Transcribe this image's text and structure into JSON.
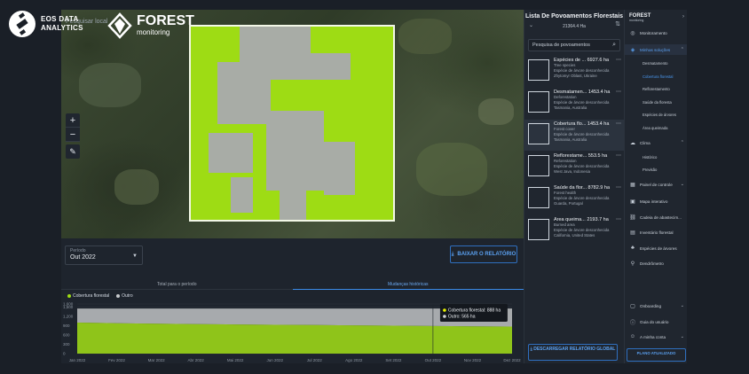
{
  "brand": {
    "eos_line1": "EOS DATA",
    "eos_line2": "ANALYTICS",
    "forest_title": "FOREST",
    "forest_sub": "monitoring"
  },
  "map": {
    "search_ghost": "Pesquisar local",
    "zoom_in": "+",
    "zoom_out": "−",
    "ruler_icon": "ruler-icon"
  },
  "bottom": {
    "period_label": "Período",
    "period_value": "Out 2022",
    "report_button": "BAIXAR O RELATÓRIO",
    "tabs": [
      "Total para o período",
      "Mudanças históricas"
    ],
    "legend": [
      {
        "label": "Cobertura florestal",
        "color": "#9edc14"
      },
      {
        "label": "Outro",
        "color": "#b9bcbf"
      }
    ]
  },
  "chart_data": {
    "type": "area",
    "x": [
      "Jan 2022",
      "Fev 2022",
      "Mar 2022",
      "Abr 2022",
      "Mai 2022",
      "Jun 2022",
      "Jul 2022",
      "Ago 2022",
      "Set 2022",
      "Out 2022",
      "Nov 2022",
      "Dez 2022"
    ],
    "series": [
      {
        "name": "Cobertura florestal",
        "color": "#8fc41a",
        "values": [
          1000,
          980,
          965,
          950,
          940,
          930,
          920,
          910,
          900,
          888,
          880,
          870
        ]
      },
      {
        "name": "Outro",
        "color": "#a7aaad",
        "values": [
          453,
          473,
          488,
          503,
          513,
          523,
          533,
          543,
          553,
          565,
          573,
          583
        ]
      }
    ],
    "yticks": [
      "1,600",
      "1,500",
      "1,200",
      "900",
      "600",
      "300",
      "0"
    ],
    "ylim": [
      0,
      1600
    ],
    "tooltip": {
      "row1": "Cobertura florestal: 888 ha",
      "row2": "Outro: 565 ha"
    }
  },
  "list": {
    "title": "Lista De Povoamentos Florestais",
    "area": "21364.4 Ha",
    "search_placeholder": "Pesquisa de povoamentos",
    "items": [
      {
        "name": "Espécies de ...",
        "area": "6927.6 ha",
        "l1": "Tree species",
        "l2": "Espécie de árvore desconhecida",
        "l3": "Zhytomyr Oblast, Ukraine"
      },
      {
        "name": "Desmatamen...",
        "area": "1453.4 ha",
        "l1": "Deforestation",
        "l2": "Espécie de árvore desconhecida",
        "l3": "Tasmania, Australia"
      },
      {
        "name": "Cobertura flo...",
        "area": "1453.4 ha",
        "l1": "Forest cover",
        "l2": "Espécie de árvore desconhecida",
        "l3": "Tasmania, Australia"
      },
      {
        "name": "Reflorestame...",
        "area": "553.5 ha",
        "l1": "Reforestation",
        "l2": "Espécie de árvore desconhecida",
        "l3": "West Java, Indonesia"
      },
      {
        "name": "Saúde da flor...",
        "area": "8782.9 ha",
        "l1": "Forest health",
        "l2": "Espécie de árvore desconhecida",
        "l3": "Guarda, Portugal"
      },
      {
        "name": "Área queima...",
        "area": "2193.7 ha",
        "l1": "Burned area",
        "l2": "Espécie de árvore desconhecida",
        "l3": "California, United States"
      }
    ],
    "download_button": "DESCARREGAR RELATÓRIO GLOBAL"
  },
  "sidebar": {
    "logo": "FOREST",
    "logo_sub": "monitoring",
    "items": [
      {
        "label": "Monitoramento",
        "icon": "globe-icon"
      },
      {
        "label": "Minhas soluções",
        "icon": "layers-icon"
      },
      {
        "label": "Clima",
        "icon": "cloud-icon"
      },
      {
        "label": "Painel de controle",
        "icon": "dashboard-icon"
      },
      {
        "label": "Mapa interativo",
        "icon": "map-icon"
      },
      {
        "label": "Cadeia de abastecim...",
        "icon": "chain-icon"
      },
      {
        "label": "Inventário florestal",
        "icon": "inventory-icon"
      },
      {
        "label": "Espécies de árvores",
        "icon": "tree-icon"
      },
      {
        "label": "Dendrômetro",
        "icon": "dendrometer-icon"
      },
      {
        "label": "Onboarding",
        "icon": "onboarding-icon"
      },
      {
        "label": "Guia do usuário",
        "icon": "info-icon"
      },
      {
        "label": "A minha conta",
        "icon": "user-icon"
      }
    ],
    "solutions": [
      "Desmatamento",
      "Cobertura florestal",
      "Reflorestamento",
      "Saúde da floresta",
      "Espécies de árvores",
      "Área queimada"
    ],
    "climate": [
      "Histórico",
      "Previsão"
    ],
    "plan_button": "PLANO ATUALIZADO"
  }
}
